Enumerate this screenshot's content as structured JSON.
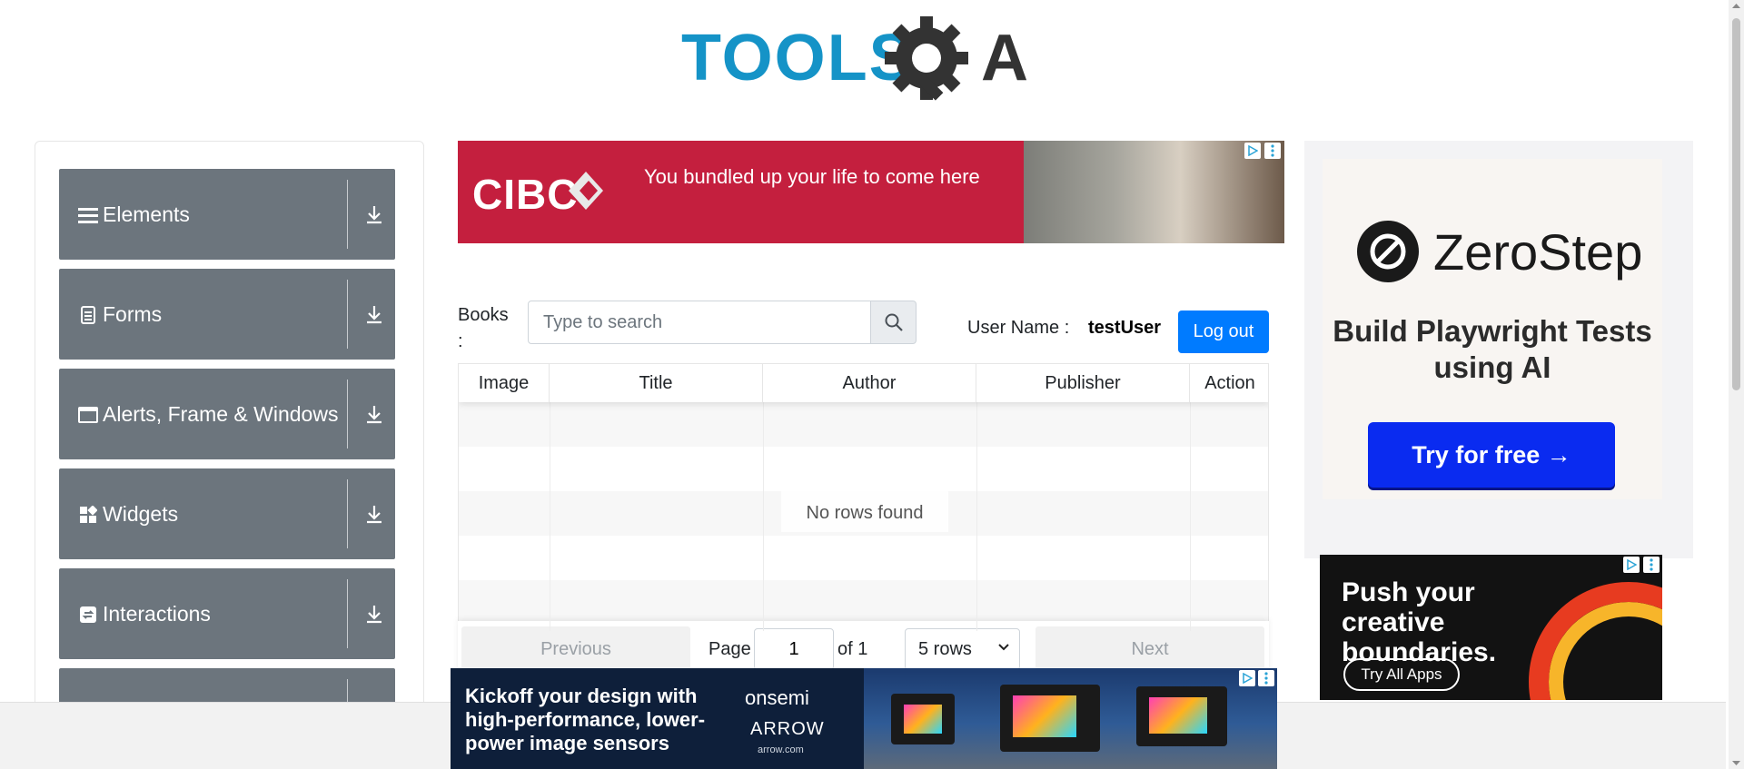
{
  "header": {
    "logo_text": "TOOLSQA"
  },
  "sidebar": {
    "groups": [
      {
        "label": "Elements",
        "icon": "hamburger-icon"
      },
      {
        "label": "Forms",
        "icon": "document-icon"
      },
      {
        "label": "Alerts, Frame & Windows",
        "icon": "window-icon"
      },
      {
        "label": "Widgets",
        "icon": "widgets-icon"
      },
      {
        "label": "Interactions",
        "icon": "interactions-icon"
      },
      {
        "label": "",
        "icon": ""
      }
    ]
  },
  "ads": {
    "cibc": {
      "brand": "CIBC",
      "tagline": "You bundled up your life to come here"
    },
    "zerostep": {
      "brand": "ZeroStep",
      "headline": "Build Playwright Tests using AI",
      "cta": "Try for free →"
    },
    "adobe": {
      "headline": "Push your creative boundaries.",
      "cta": "Try All Apps"
    },
    "onsemi": {
      "copy": "Kickoff your design with high-performance, lower-power image sensors",
      "brand1": "onsemi",
      "brand2": "ARROW",
      "brand3": "arrow.com"
    }
  },
  "books": {
    "label": "Books :",
    "search_placeholder": "Type to search",
    "username_label": "User Name :",
    "username_value": "testUser",
    "logout_label": "Log out"
  },
  "table": {
    "columns": [
      "Image",
      "Title",
      "Author",
      "Publisher",
      "Action"
    ],
    "empty_message": "No rows found"
  },
  "pagination": {
    "previous_label": "Previous",
    "page_label": "Page",
    "page_value": "1",
    "of_label": "of 1",
    "rows_selected": "5 rows",
    "next_label": "Next"
  },
  "colors": {
    "sidebar_bg": "#6c757d",
    "primary": "#007bff",
    "logo_blue": "#1593c7",
    "logo_dark": "#333333"
  }
}
